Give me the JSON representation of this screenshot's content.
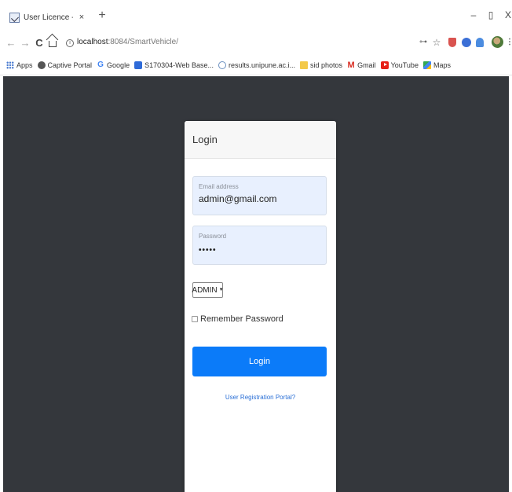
{
  "browser": {
    "tab": {
      "title": "User Licence - Login",
      "close": "×"
    },
    "new_tab": "+",
    "window_controls": {
      "minimize": "–",
      "maximize": "▯",
      "close": "X"
    },
    "nav": {
      "back": "←",
      "forward": "→",
      "reload": "C"
    },
    "url": {
      "host": "localhost",
      "path": ":8084/SmartVehicle/"
    },
    "toolbar_icons": {
      "key": "⊶",
      "star": "☆",
      "menu": "⋮",
      "info": "i"
    },
    "bookmarks": [
      {
        "label": "Apps",
        "icon": "apps-icon"
      },
      {
        "label": "Captive Portal",
        "icon": "portal-icon"
      },
      {
        "label": "Google",
        "icon": "google-icon",
        "glyph": "G"
      },
      {
        "label": "S170304-Web Base...",
        "icon": "doc-icon"
      },
      {
        "label": "results.unipune.ac.i...",
        "icon": "globe-icon"
      },
      {
        "label": "sid photos",
        "icon": "folder-icon"
      },
      {
        "label": "Gmail",
        "icon": "gmail-icon",
        "glyph": "M"
      },
      {
        "label": "YouTube",
        "icon": "youtube-icon"
      },
      {
        "label": "Maps",
        "icon": "maps-icon"
      }
    ]
  },
  "login": {
    "header": "Login",
    "email": {
      "label": "Email address",
      "value": "admin@gmail.com"
    },
    "password": {
      "label": "Password",
      "value": "•••••"
    },
    "role": {
      "selected": "ADMIN",
      "caret": "▼"
    },
    "remember_label": "Remember Password",
    "submit_label": "Login",
    "register_link": "User Registration Portal?"
  },
  "colors": {
    "page_bg": "#34373c",
    "button": "#0b7bf9",
    "field_bg": "#e8f0fe",
    "link": "#2a6fd6"
  }
}
